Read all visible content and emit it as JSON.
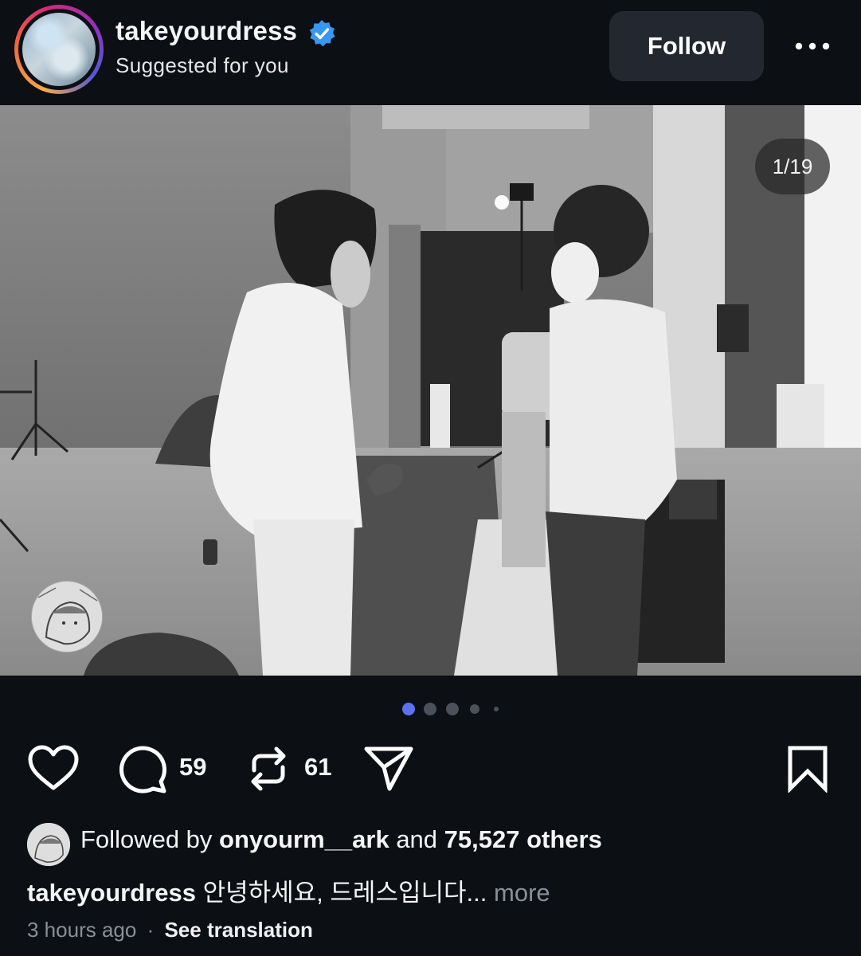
{
  "header": {
    "username": "takeyourdress",
    "verified": true,
    "subtitle": "Suggested for you",
    "follow_label": "Follow",
    "more_icon": "ellipsis-icon",
    "story_ring_colors": [
      "#f9a94a",
      "#d62976",
      "#4f5bd5"
    ]
  },
  "post": {
    "carousel_counter": "1/19",
    "current_slide": 1,
    "total_slides": 19,
    "photo_description_icon": "photo",
    "indicator": {
      "active_index": 0,
      "visible_dots": 5,
      "active_color": "#5b73f2"
    }
  },
  "actions": {
    "like_icon": "heart-icon",
    "comment_icon": "comment-icon",
    "comment_count": "59",
    "repost_icon": "repost-icon",
    "repost_count": "61",
    "share_icon": "send-icon",
    "save_icon": "bookmark-icon"
  },
  "footer": {
    "followed_prefix": "Followed by",
    "followed_user": "onyourm__ark",
    "followed_and": "and",
    "followed_others": "75,527 others",
    "caption_user": "takeyourdress",
    "caption_text": "안녕하세요, 드레스입니다...",
    "more_label": "more",
    "timestamp": "3 hours ago",
    "separator": "·",
    "translation_label": "See translation"
  },
  "colors": {
    "background": "#0c0f14",
    "button_bg": "#23272f",
    "verified": "#3897f0",
    "muted_text": "#8a8f98"
  }
}
